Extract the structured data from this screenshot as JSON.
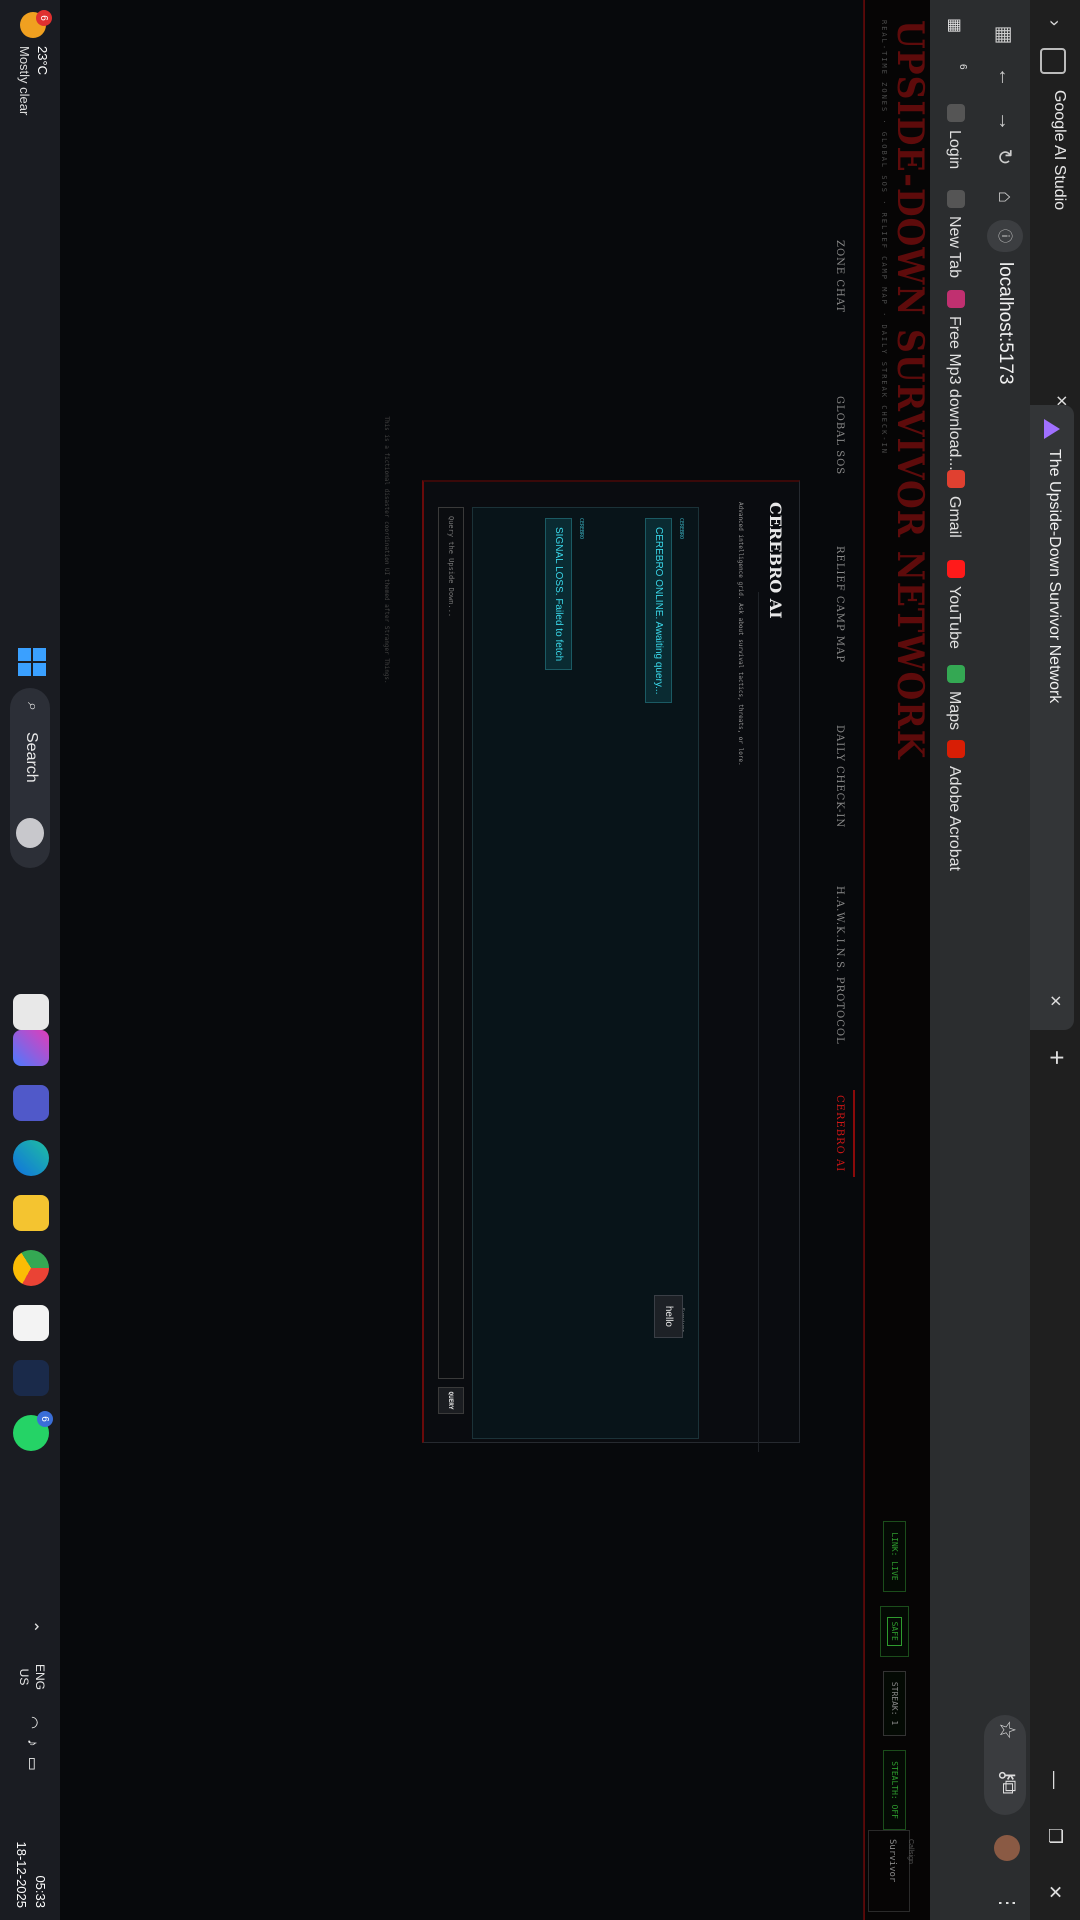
{
  "browser": {
    "tabs": [
      {
        "label": "Google AI Studio"
      },
      {
        "label": "The Upside-Down Survivor Network"
      }
    ],
    "url": "localhost:5173",
    "bookmarks": [
      "Login",
      "New Tab",
      "Free Mp3 download...",
      "Gmail",
      "YouTube",
      "Maps",
      "Adobe Acrobat"
    ],
    "extension_badge": "6"
  },
  "app": {
    "title": "UPSIDE-DOWN SURVIVOR NETWORK",
    "tagline": "REAL-TIME ZONES · GLOBAL SOS · RELIEF CAMP MAP · DAILY STREAK CHECK-IN",
    "status": {
      "link": "LINK: LIVE",
      "safe": "SAFE",
      "streak": "STREAK: 1",
      "stealth": "STEALTH: OFF"
    },
    "user": {
      "role": "Callsign",
      "name": "Survivor"
    },
    "nav": [
      "ZONE CHAT",
      "GLOBAL SOS",
      "RELIEF CAMP MAP",
      "DAILY CHECK-IN",
      "H.A.W.K.I.N.S. PROTOCOL",
      "CEREBRO AI"
    ],
    "disclaimer": "This is a fictional disaster coordination UI themed after Stranger Things."
  },
  "cerebro": {
    "title": "CEREBRO AI",
    "description": "Advanced intelligence grid. Ask about survival tactics, threats, or lore.",
    "messages": [
      {
        "sender": "CEREBRO",
        "text": "CEREBRO ONLINE. Awaiting query..."
      },
      {
        "sender": "Survivor",
        "text": "hello"
      },
      {
        "sender": "CEREBRO",
        "text": "SIGNAL LOSS. Failed to fetch"
      }
    ],
    "input_placeholder": "Query the Upside Down...",
    "submit_label": "QUERY"
  },
  "taskbar": {
    "weather_badge": "6",
    "temperature": "23°C",
    "condition": "Mostly clear",
    "search_label": "Search",
    "whatsapp_badge": "6",
    "language": "ENG",
    "region": "US",
    "time": "05:33",
    "date": "18-12-2025"
  }
}
